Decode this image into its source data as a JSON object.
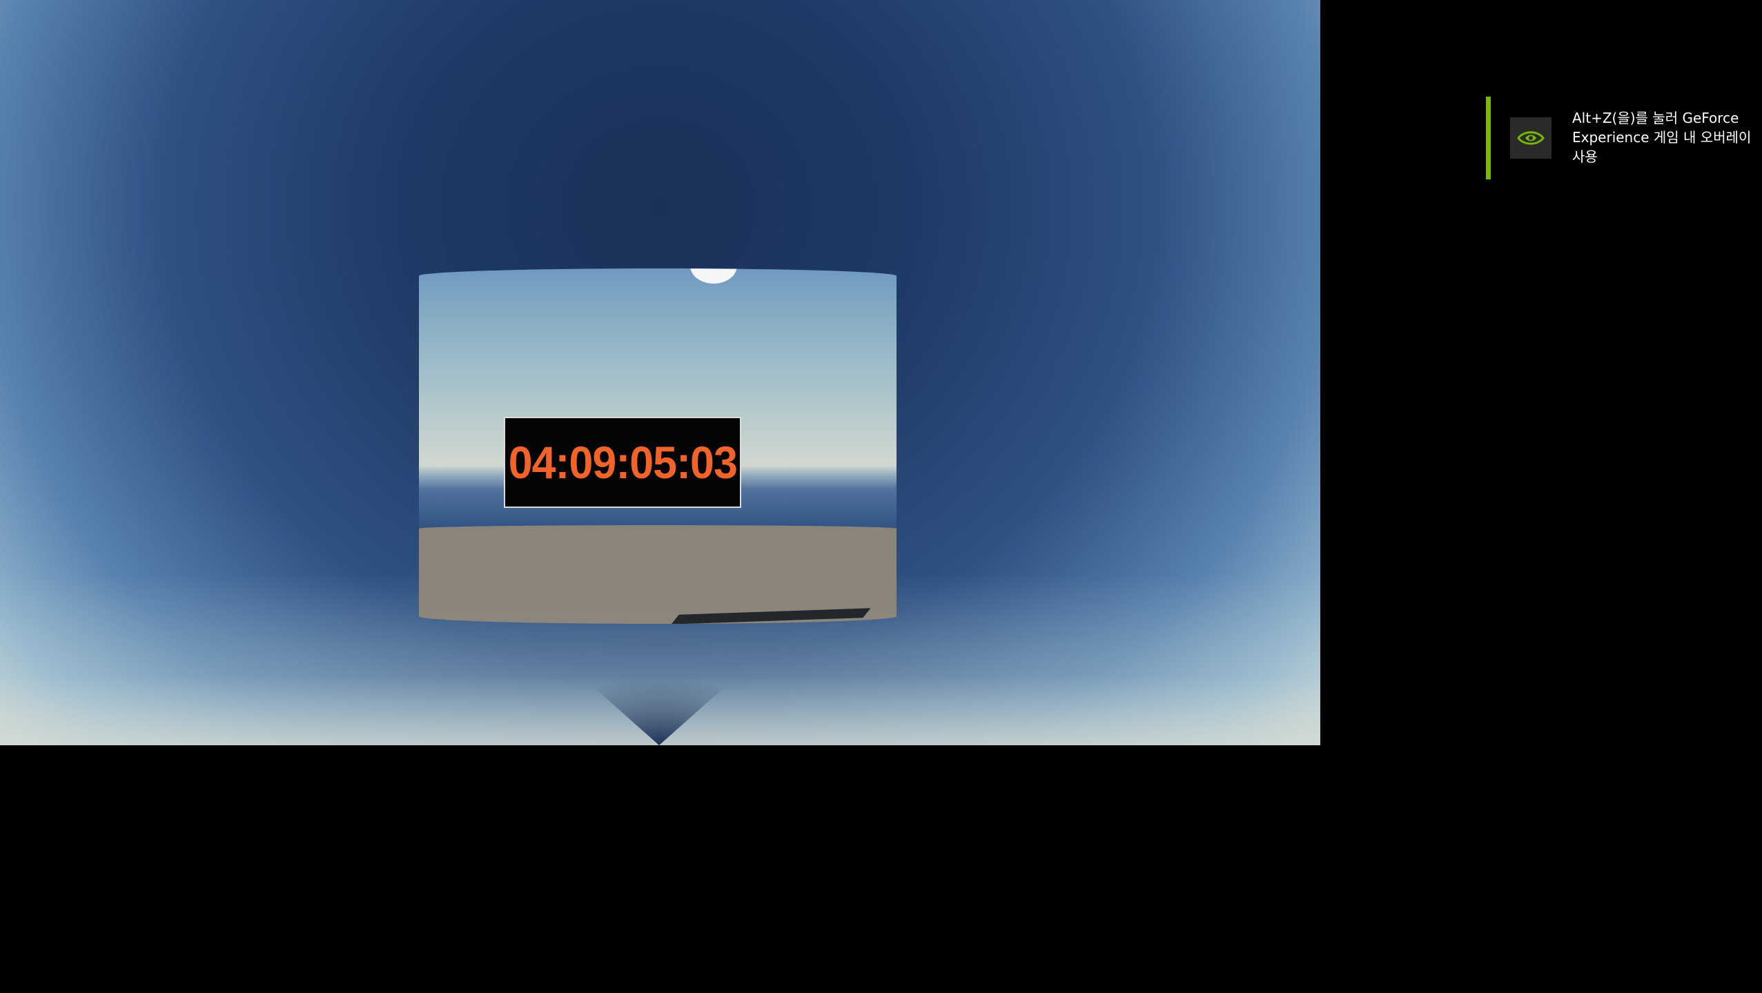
{
  "scene": {
    "timer_text": "04:09:05:03"
  },
  "overlay_notification": {
    "message": "Alt+Z(을)를 눌러 GeForce Experience 게임 내 오버레이 사용",
    "icon": "nvidia-logo-icon",
    "accent_color": "#76b900"
  },
  "colors": {
    "timer": "#f2632a",
    "sky_top": "#1b3158",
    "sky_edge": "#c3d3d6"
  }
}
